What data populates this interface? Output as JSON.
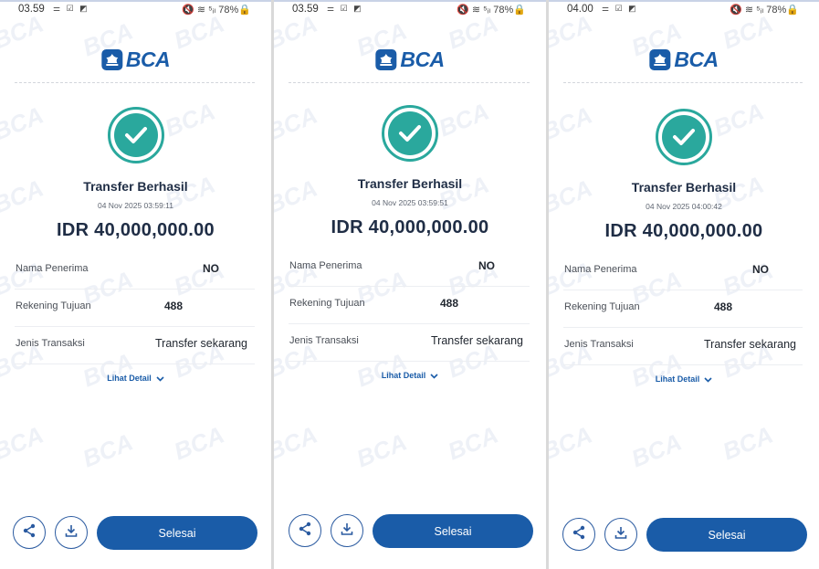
{
  "brand": {
    "logo_text": "BCA",
    "watermark_text": "BCA",
    "primary_color": "#1a5ca8",
    "success_color": "#2aa89d"
  },
  "labels": {
    "title": "Transfer Berhasil",
    "recipient_name": "Nama Penerima",
    "destination_account": "Rekening Tujuan",
    "transaction_type": "Jenis Transaksi",
    "view_detail": "Lihat Detail",
    "done": "Selesai"
  },
  "icons": {
    "success": "check-circle-icon",
    "share": "share-icon",
    "download": "download-icon",
    "expand": "chevron-down-icon"
  },
  "screens": [
    {
      "status": {
        "time": "03.59",
        "icons": "⚌ ☑ ◩",
        "right": "🔇 ≋ ⁵ᵢₗ 78%🔒",
        "battery": "78%"
      },
      "date": "04 Nov 2025 03:59:11",
      "amount": "IDR 40,000,000.00",
      "recipient_name": "NO",
      "destination_account": "488",
      "transaction_type": "Transfer sekarang"
    },
    {
      "status": {
        "time": "03.59",
        "icons": "⚌ ☑ ◩",
        "right": "🔇 ≋ ⁵ᵢₗ 78%🔒",
        "battery": "78%"
      },
      "date": "04 Nov 2025 03:59:51",
      "amount": "IDR 40,000,000.00",
      "recipient_name": "NO",
      "destination_account": "488",
      "transaction_type": "Transfer sekarang"
    },
    {
      "status": {
        "time": "04.00",
        "icons": "⚌ ☑ ◩",
        "right": "🔇 ≋ ⁵ᵢₗ 78%🔒",
        "battery": "78%"
      },
      "date": "04 Nov 2025 04:00:42",
      "amount": "IDR 40,000,000.00",
      "recipient_name": "NO",
      "destination_account": "488",
      "transaction_type": "Transfer sekarang"
    }
  ]
}
